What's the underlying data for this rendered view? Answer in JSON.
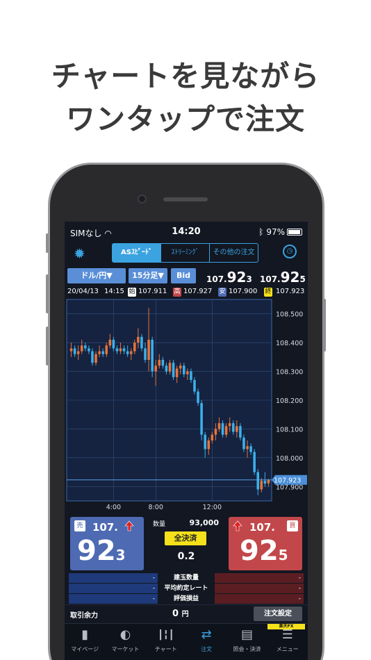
{
  "headline": {
    "line1": "チャートを見ながら",
    "line2": "ワンタップで注文"
  },
  "status": {
    "carrier": "SIMなし",
    "time": "14:20",
    "battery": "97%"
  },
  "topbar": {
    "tabs": [
      {
        "label": "ASｽﾋﾟｰﾄﾞ",
        "active": true
      },
      {
        "label": "ｽﾄﾘｰﾐﾝｸﾞ",
        "active": false
      },
      {
        "label": "その他の注文",
        "active": false
      }
    ]
  },
  "controls": {
    "pair": "ドル/円▼",
    "interval": "15分足▼",
    "price_type": "Bid"
  },
  "quotes": {
    "bid": {
      "small": "107.",
      "big": "92",
      "end": "3"
    },
    "ask": {
      "small": "107.",
      "big": "92",
      "end": "5"
    }
  },
  "ohlc": {
    "date": "20/04/13",
    "time": "14:15",
    "open_tag": "始",
    "open": "107.911",
    "high_tag": "高",
    "high": "107.927",
    "low_tag": "安",
    "low": "107.900",
    "close_tag": "終",
    "close": "107.923"
  },
  "chart_data": {
    "type": "candlestick",
    "y_ticks": [
      "108.500",
      "108.400",
      "108.300",
      "108.200",
      "108.100",
      "108.000",
      "107.900"
    ],
    "ylim": [
      107.85,
      108.55
    ],
    "x_ticks": [
      "4:00",
      "8:00",
      "12:00"
    ],
    "current_price_label": "107.923",
    "current_price": 107.923,
    "up_color": "#e8743a",
    "down_color": "#3bb0ea",
    "candles": [
      [
        108.37,
        108.4,
        108.35,
        108.38
      ],
      [
        108.38,
        108.39,
        108.35,
        108.36
      ],
      [
        108.36,
        108.39,
        108.34,
        108.37
      ],
      [
        108.37,
        108.41,
        108.36,
        108.39
      ],
      [
        108.39,
        108.4,
        108.37,
        108.38
      ],
      [
        108.38,
        108.39,
        108.36,
        108.37
      ],
      [
        108.37,
        108.38,
        108.32,
        108.33
      ],
      [
        108.33,
        108.37,
        108.32,
        108.36
      ],
      [
        108.36,
        108.39,
        108.35,
        108.37
      ],
      [
        108.37,
        108.38,
        108.35,
        108.36
      ],
      [
        108.36,
        108.4,
        108.35,
        108.39
      ],
      [
        108.39,
        108.43,
        108.38,
        108.41
      ],
      [
        108.41,
        108.42,
        108.37,
        108.38
      ],
      [
        108.38,
        108.39,
        108.36,
        108.37
      ],
      [
        108.37,
        108.4,
        108.36,
        108.38
      ],
      [
        108.38,
        108.39,
        108.36,
        108.37
      ],
      [
        108.37,
        108.39,
        108.35,
        108.36
      ],
      [
        108.36,
        108.38,
        108.34,
        108.37
      ],
      [
        108.37,
        108.41,
        108.36,
        108.4
      ],
      [
        108.4,
        108.45,
        108.38,
        108.42
      ],
      [
        108.42,
        108.43,
        108.37,
        108.38
      ],
      [
        108.38,
        108.4,
        108.33,
        108.34
      ],
      [
        108.34,
        108.52,
        108.3,
        108.41
      ],
      [
        108.41,
        108.42,
        108.28,
        108.3
      ],
      [
        108.3,
        108.34,
        108.25,
        108.32
      ],
      [
        108.32,
        108.36,
        108.31,
        108.34
      ],
      [
        108.34,
        108.35,
        108.31,
        108.32
      ],
      [
        108.32,
        108.33,
        108.29,
        108.3
      ],
      [
        108.3,
        108.34,
        108.29,
        108.33
      ],
      [
        108.33,
        108.34,
        108.27,
        108.28
      ],
      [
        108.28,
        108.32,
        108.26,
        108.31
      ],
      [
        108.31,
        108.33,
        108.29,
        108.32
      ],
      [
        108.32,
        108.33,
        108.28,
        108.29
      ],
      [
        108.29,
        108.31,
        108.27,
        108.3
      ],
      [
        108.3,
        108.31,
        108.26,
        108.27
      ],
      [
        108.27,
        108.28,
        108.22,
        108.23
      ],
      [
        108.23,
        108.24,
        108.18,
        108.19
      ],
      [
        108.19,
        108.2,
        108.06,
        108.08
      ],
      [
        108.08,
        108.09,
        108.0,
        108.03
      ],
      [
        108.03,
        108.07,
        108.01,
        108.06
      ],
      [
        108.06,
        108.09,
        108.05,
        108.08
      ],
      [
        108.08,
        108.12,
        108.06,
        108.1
      ],
      [
        108.1,
        108.14,
        108.09,
        108.12
      ],
      [
        108.12,
        108.13,
        108.07,
        108.08
      ],
      [
        108.08,
        108.12,
        108.07,
        108.11
      ],
      [
        108.11,
        108.14,
        108.09,
        108.12
      ],
      [
        108.12,
        108.13,
        108.08,
        108.09
      ],
      [
        108.09,
        108.13,
        108.07,
        108.11
      ],
      [
        108.11,
        108.12,
        108.06,
        108.07
      ],
      [
        108.07,
        108.08,
        108.02,
        108.03
      ],
      [
        108.03,
        108.06,
        108.0,
        108.04
      ],
      [
        108.04,
        108.05,
        108.01,
        108.02
      ],
      [
        108.02,
        108.03,
        107.94,
        107.95
      ],
      [
        107.95,
        107.96,
        107.87,
        107.89
      ],
      [
        107.89,
        107.93,
        107.88,
        107.92
      ],
      [
        107.92,
        107.95,
        107.9,
        107.91
      ],
      [
        107.911,
        107.927,
        107.9,
        107.923
      ]
    ]
  },
  "trade": {
    "sell_label": "売",
    "buy_label": "買",
    "qty_label": "数量",
    "qty_value": "93,000",
    "close_all": "全決済",
    "spread": "0.2"
  },
  "positions": {
    "rows": [
      {
        "left": "-",
        "center": "建玉数量",
        "right": "-"
      },
      {
        "left": "-",
        "center": "平均約定レート",
        "right": "-"
      },
      {
        "left": "-",
        "center": "評価損益",
        "right": "-"
      }
    ]
  },
  "margin": {
    "label": "取引余力",
    "value": "0",
    "unit": "円",
    "settings_button": "注文設定"
  },
  "tabbar": {
    "items": [
      {
        "label": "マイページ",
        "icon": "bookmark-icon",
        "glyph": "▮"
      },
      {
        "label": "マーケット",
        "icon": "globe-icon",
        "glyph": "◐"
      },
      {
        "label": "チャート",
        "icon": "candles-icon",
        "glyph": "┃╏┃"
      },
      {
        "label": "注文",
        "icon": "order-icon",
        "glyph": "⇄"
      },
      {
        "label": "照会・決済",
        "icon": "document-icon",
        "glyph": "▤"
      },
      {
        "label": "メニュー",
        "icon": "menu-icon",
        "glyph": "☰"
      }
    ],
    "active": 3,
    "badge": "楽天FX"
  }
}
